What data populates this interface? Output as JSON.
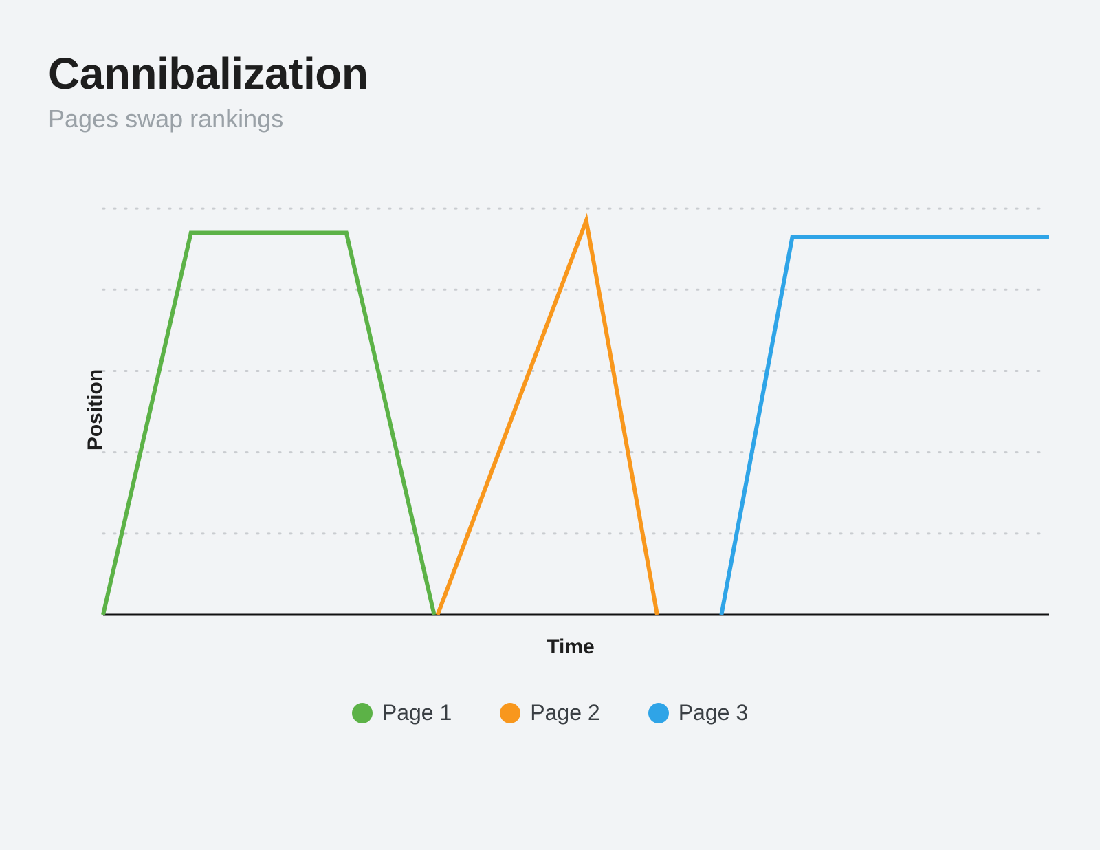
{
  "title": "Cannibalization",
  "subtitle": "Pages swap rankings",
  "xlabel": "Time",
  "ylabel": "Position",
  "legend": [
    {
      "name": "Page 1",
      "color": "#5cb247"
    },
    {
      "name": "Page 2",
      "color": "#f8971d"
    },
    {
      "name": "Page 3",
      "color": "#2fa4e7"
    }
  ],
  "chart_data": {
    "type": "line",
    "xlabel": "Time",
    "ylabel": "Position",
    "xlim": [
      0,
      14
    ],
    "ylim": [
      0,
      5.5
    ],
    "grid_y": [
      1,
      2,
      3,
      4,
      5
    ],
    "series": [
      {
        "name": "Page 1",
        "color": "#5cb247",
        "points": [
          [
            0,
            0
          ],
          [
            1.3,
            4.7
          ],
          [
            3.6,
            4.7
          ],
          [
            4.9,
            0
          ]
        ]
      },
      {
        "name": "Page 2",
        "color": "#f8971d",
        "points": [
          [
            4.95,
            0
          ],
          [
            7.15,
            4.85
          ],
          [
            8.2,
            0
          ]
        ]
      },
      {
        "name": "Page 3",
        "color": "#2fa4e7",
        "points": [
          [
            9.15,
            0
          ],
          [
            10.2,
            4.65
          ],
          [
            14,
            4.65
          ]
        ]
      }
    ]
  }
}
